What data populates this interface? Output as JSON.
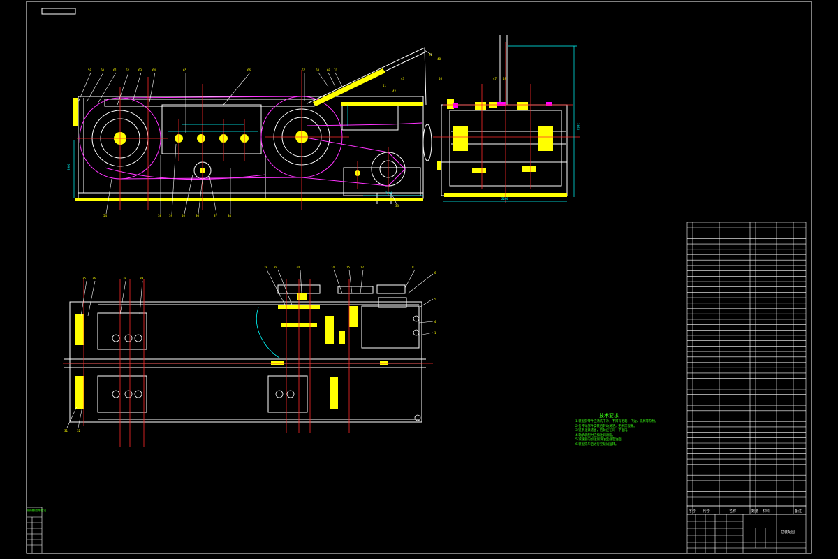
{
  "colors": {
    "background": "#000000",
    "outline": "#ffffff",
    "centerline": "#ff2a2a",
    "part": "#ffff00",
    "belt": "#ff33ff",
    "dimension": "#00ffff",
    "note": "#39ff14",
    "accent": "#ff00ff"
  },
  "dimensions": {
    "front_height": "2900",
    "front_bottom": "3200",
    "side_height": "1660",
    "side_width": "2260"
  },
  "tech_notes": {
    "title": "技术要求",
    "items": [
      "1.装配前零件应清洗干净，不得有毛刺、飞边、铁屑等杂物。",
      "2.各传动部件安装后转动灵活，无卡滞现象。",
      "3.链条张紧适当，链轮应在同一平面内。",
      "4.轴承装配时应加注润滑脂。",
      "5.减速器内加注润滑油至规定油面。",
      "6.装配完毕后进行空载试运转。"
    ]
  },
  "parts_table": {
    "header": [
      "序号",
      "代号",
      "名称",
      "数量",
      "材料",
      "备注"
    ]
  },
  "title_block": {
    "label": "总装配图"
  },
  "side_panel": {
    "label": "借(通)用件登记"
  }
}
